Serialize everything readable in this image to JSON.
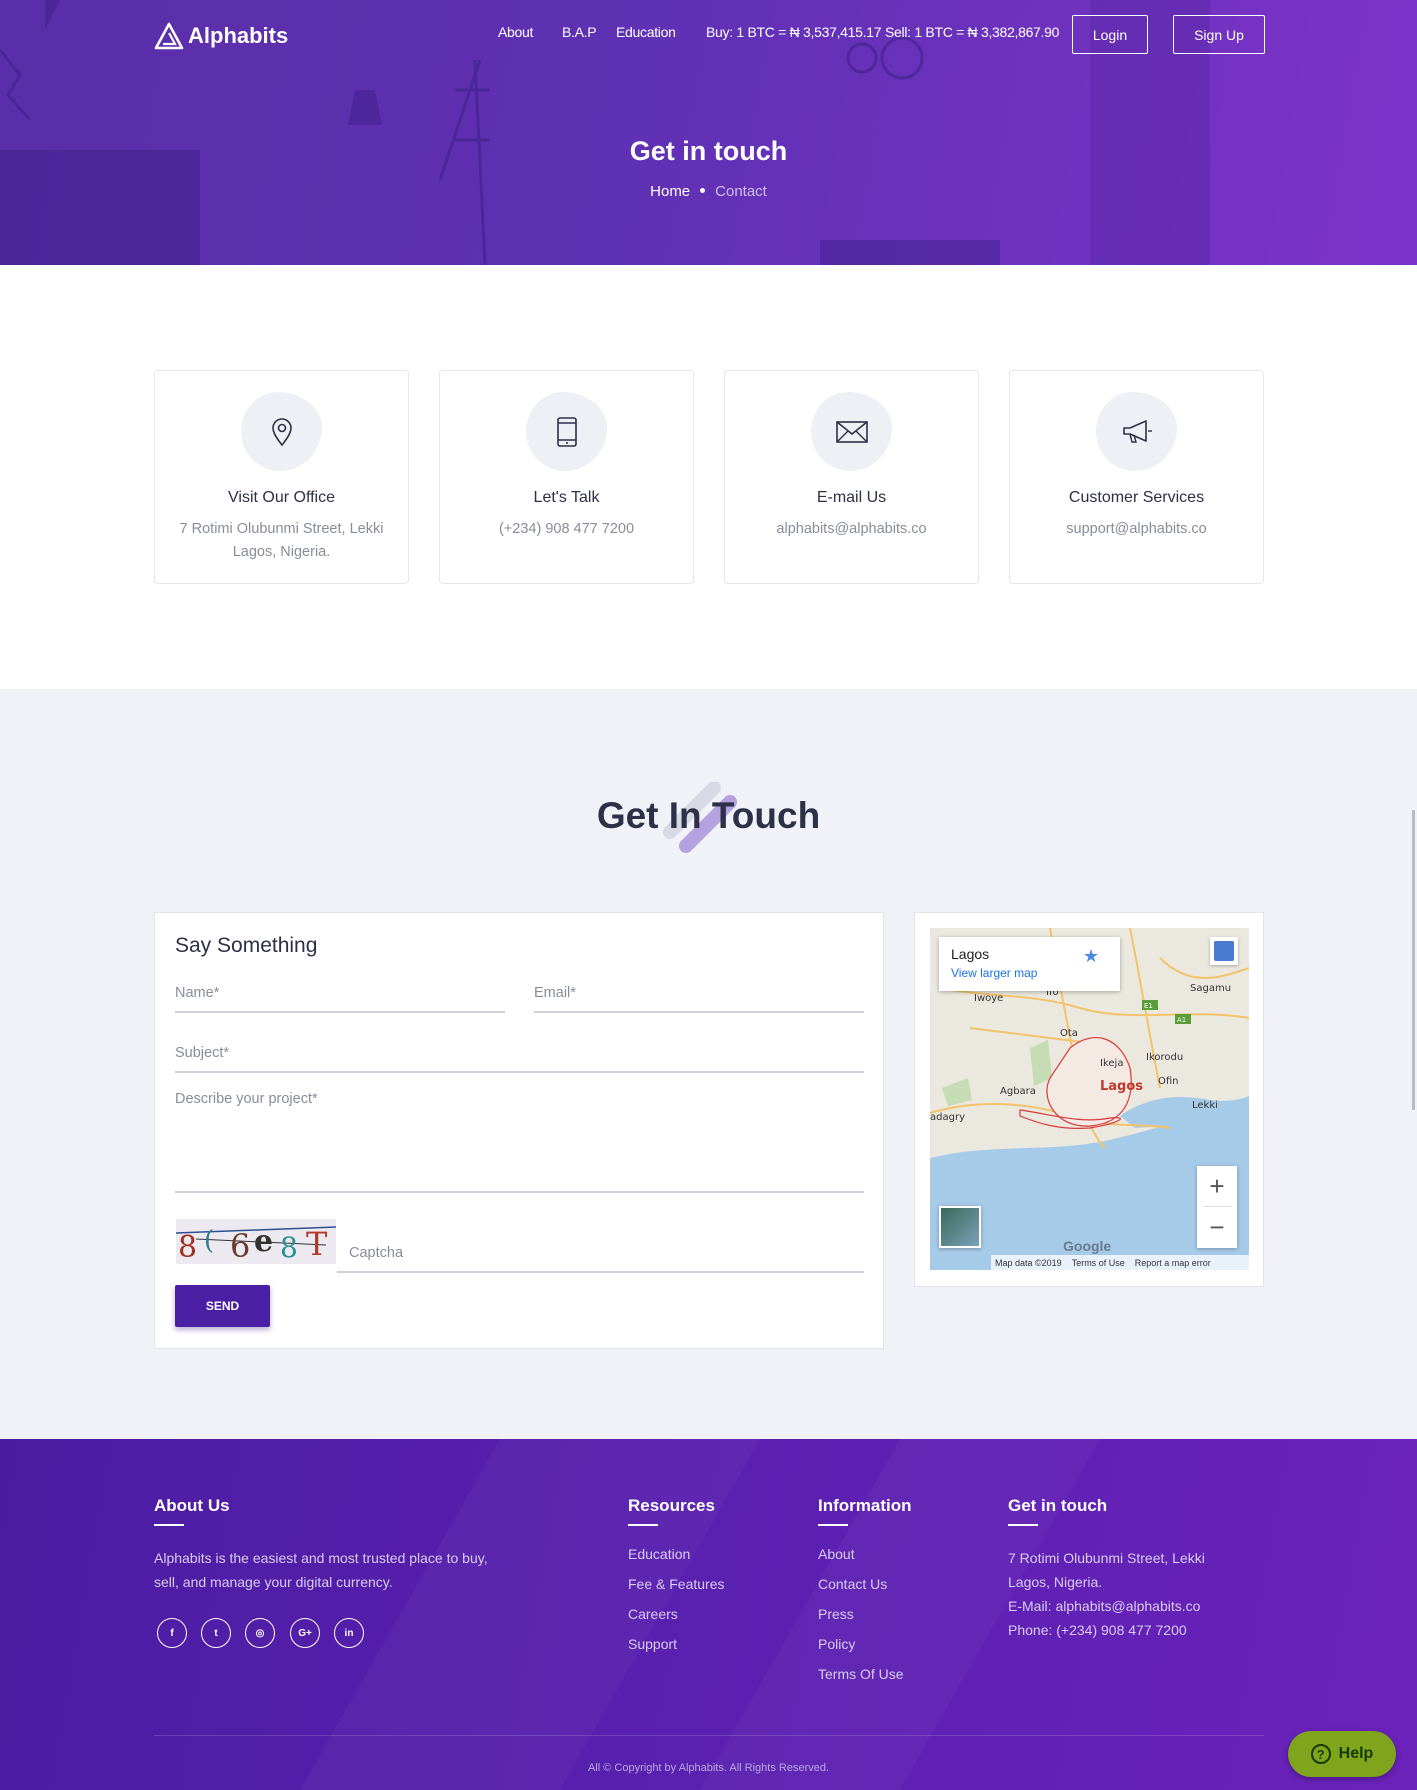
{
  "nav": {
    "brand": "Alphabits",
    "links": [
      "About",
      "B.A.P",
      "Education"
    ],
    "buy_rate": "Buy: 1 BTC = ₦ 3,537,415.17",
    "sell_rate": "Sell: 1 BTC = ₦ 3,382,867.90",
    "login": "Login",
    "signup": "Sign Up"
  },
  "hero": {
    "title": "Get in touch",
    "crumb_home": "Home",
    "crumb_current": "Contact"
  },
  "cards": [
    {
      "icon": "location-pin-icon",
      "title": "Visit Our Office",
      "text": "7 Rotimi Olubunmi Street, Lekki Lagos, Nigeria."
    },
    {
      "icon": "phone-icon",
      "title": "Let's Talk",
      "text": "(+234) 908 477 7200"
    },
    {
      "icon": "envelope-icon",
      "title": "E-mail Us",
      "text": "alphabits@alphabits.co"
    },
    {
      "icon": "megaphone-icon",
      "title": "Customer Services",
      "text": "support@alphabits.co"
    }
  ],
  "section": {
    "title": "Get In Touch"
  },
  "form": {
    "heading": "Say Something",
    "name": "Name*",
    "email": "Email*",
    "subject": "Subject*",
    "project": "Describe your project*",
    "captcha_code": "8C6e8T",
    "captcha_placeholder": "Captcha",
    "send": "SEND"
  },
  "map": {
    "place": "Lagos",
    "larger_link": "View larger map",
    "labels": [
      "Iwoye",
      "Ifo",
      "Sagamu",
      "Ota",
      "Ikeja",
      "Ikorodu",
      "Agbara",
      "Lagos",
      "Ofin",
      "Lekki",
      "adagry"
    ],
    "road_badges": [
      "E1",
      "A1"
    ],
    "google": "Google",
    "map_data": "Map data ©2019",
    "terms": "Terms of Use",
    "report": "Report a map error",
    "zoom_in": "+",
    "zoom_out": "−"
  },
  "footer": {
    "about_title": "About Us",
    "about_text": "Alphabits is the easiest and most trusted place to buy, sell, and manage your digital currency.",
    "social": [
      {
        "icon": "facebook-icon",
        "glyph": "f"
      },
      {
        "icon": "twitter-icon",
        "glyph": "t"
      },
      {
        "icon": "instagram-icon",
        "glyph": "◎"
      },
      {
        "icon": "google-plus-icon",
        "glyph": "G+"
      },
      {
        "icon": "linkedin-icon",
        "glyph": "in"
      }
    ],
    "resources_title": "Resources",
    "resources": [
      "Education",
      "Fee & Features",
      "Careers",
      "Support"
    ],
    "info_title": "Information",
    "info": [
      "About",
      "Contact Us",
      "Press",
      "Policy",
      "Terms Of Use"
    ],
    "touch_title": "Get in touch",
    "touch_lines": [
      "7 Rotimi Olubunmi Street, Lekki",
      "Lagos, Nigeria.",
      "E-Mail: alphabits@alphabits.co",
      "Phone: (+234) 908 477 7200"
    ],
    "copyright": "All © Copyright by Alphabits. All Rights Reserved."
  },
  "help": {
    "label": "Help",
    "icon": "question-icon"
  },
  "colors": {
    "primary": "#5f31b4",
    "button": "#4a1fa3",
    "help": "#7ea51c",
    "section_bg": "#f1f2f7"
  }
}
